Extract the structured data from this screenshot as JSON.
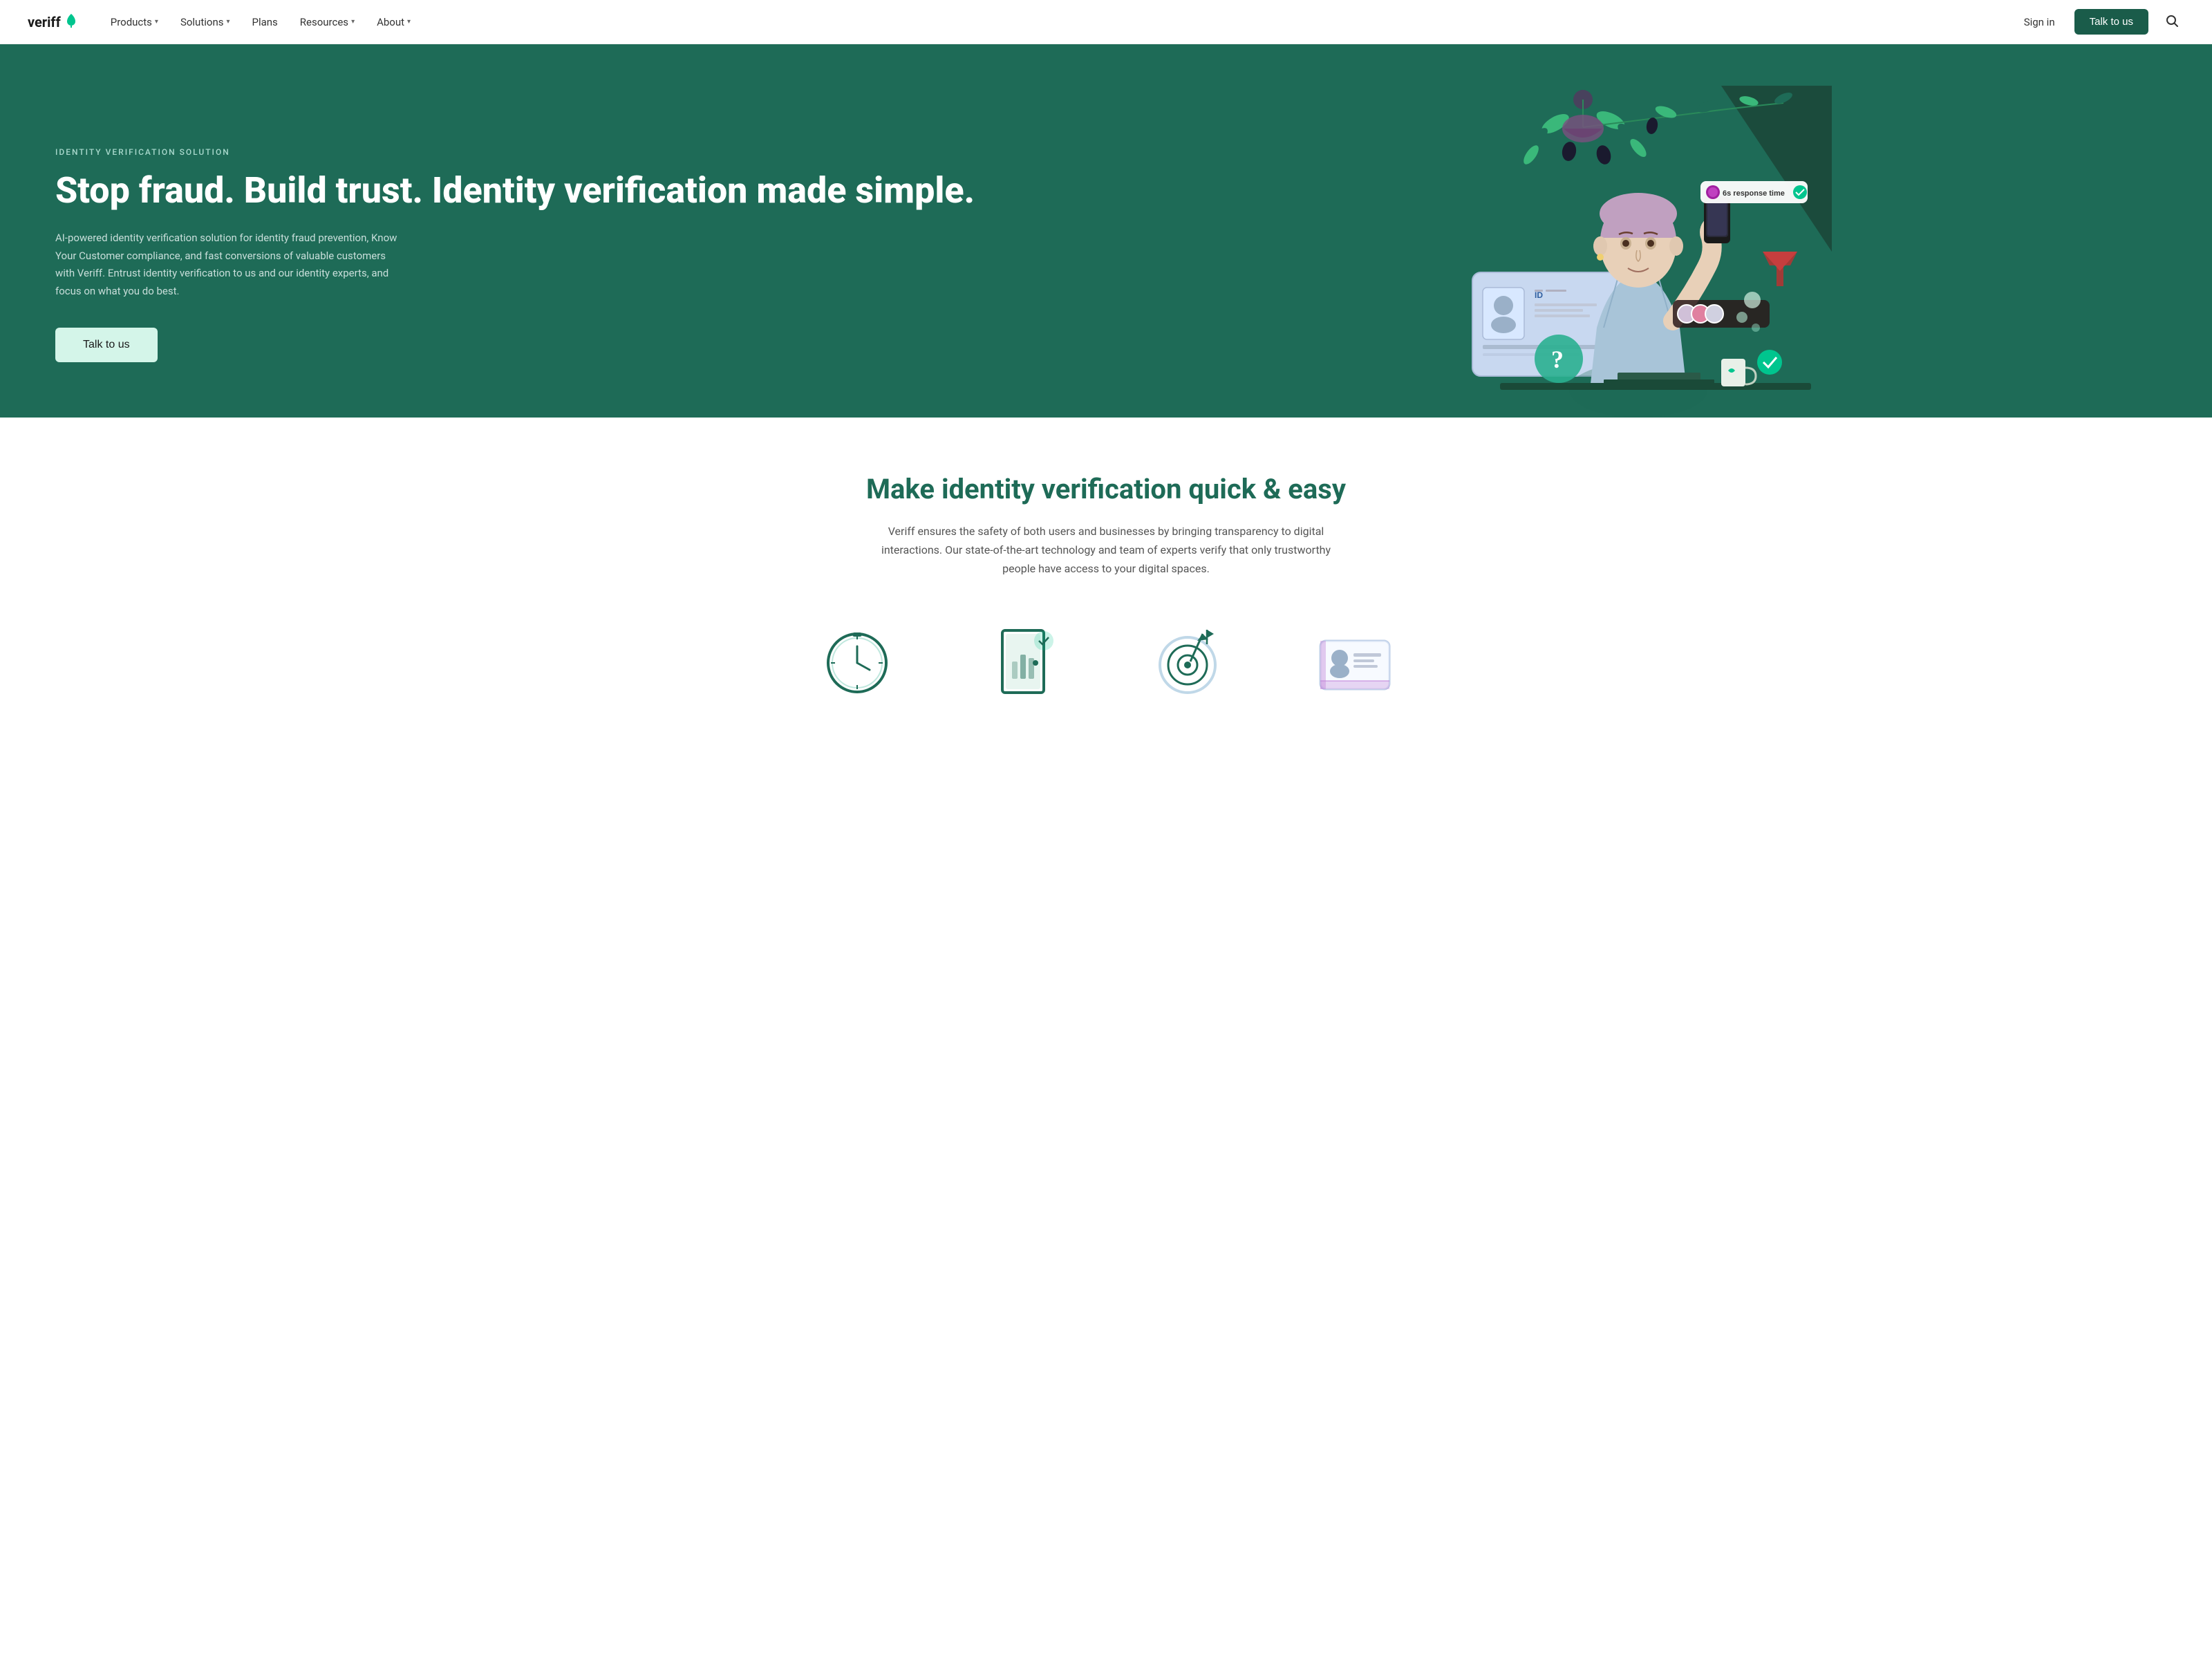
{
  "logo": {
    "text": "veriff",
    "leaf": "🌿"
  },
  "nav": {
    "items": [
      {
        "label": "Products",
        "hasChevron": true
      },
      {
        "label": "Solutions",
        "hasChevron": true
      },
      {
        "label": "Plans",
        "hasChevron": false
      },
      {
        "label": "Resources",
        "hasChevron": true
      },
      {
        "label": "About",
        "hasChevron": true
      }
    ],
    "signin": "Sign in",
    "cta": "Talk to us"
  },
  "hero": {
    "eyebrow": "IDENTITY VERIFICATION SOLUTION",
    "headline": "Stop fraud. Build trust. Identity verification made simple.",
    "body": "AI-powered identity verification solution for identity fraud prevention, Know Your Customer compliance, and fast conversions of valuable customers with Veriff. Entrust identity verification to us and our identity experts, and focus on what you do best.",
    "cta": "Talk to us",
    "badge": "6s response time"
  },
  "section2": {
    "title": "Make identity verification quick & easy",
    "body": "Veriff ensures the safety of both users and businesses by bringing transparency to digital interactions. Our state-of-the-art technology and team of experts verify that only trustworthy people have access to your digital spaces."
  },
  "colors": {
    "teal": "#1e6b57",
    "light_teal": "#d4f5e9",
    "nav_cta_bg": "#1a5c4a",
    "accent": "#00c58e"
  }
}
